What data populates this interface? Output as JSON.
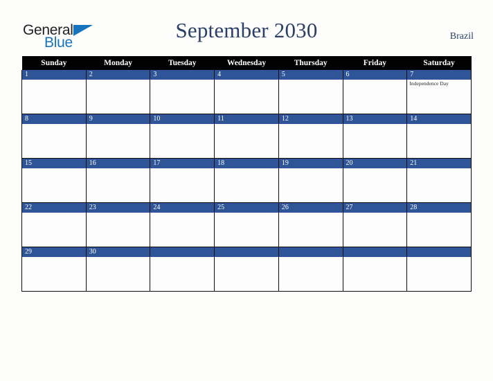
{
  "brand": {
    "name_part1": "General",
    "name_part2": "Blue",
    "accent_color": "#1574bb",
    "text_color": "#231f20"
  },
  "header": {
    "title": "September 2030",
    "country": "Brazil",
    "title_color": "#2b4065"
  },
  "calendar": {
    "month": "September",
    "year": "2030",
    "weekday_headers": [
      "Sunday",
      "Monday",
      "Tuesday",
      "Wednesday",
      "Thursday",
      "Friday",
      "Saturday"
    ],
    "header_bg": "#020202",
    "header_text": "#ffffff",
    "daynum_bg": "#2f5497",
    "daynum_text": "#ffffff",
    "weeks": [
      [
        {
          "day": "1",
          "events": []
        },
        {
          "day": "2",
          "events": []
        },
        {
          "day": "3",
          "events": []
        },
        {
          "day": "4",
          "events": []
        },
        {
          "day": "5",
          "events": []
        },
        {
          "day": "6",
          "events": []
        },
        {
          "day": "7",
          "events": [
            "Independence Day"
          ]
        }
      ],
      [
        {
          "day": "8",
          "events": []
        },
        {
          "day": "9",
          "events": []
        },
        {
          "day": "10",
          "events": []
        },
        {
          "day": "11",
          "events": []
        },
        {
          "day": "12",
          "events": []
        },
        {
          "day": "13",
          "events": []
        },
        {
          "day": "14",
          "events": []
        }
      ],
      [
        {
          "day": "15",
          "events": []
        },
        {
          "day": "16",
          "events": []
        },
        {
          "day": "17",
          "events": []
        },
        {
          "day": "18",
          "events": []
        },
        {
          "day": "19",
          "events": []
        },
        {
          "day": "20",
          "events": []
        },
        {
          "day": "21",
          "events": []
        }
      ],
      [
        {
          "day": "22",
          "events": []
        },
        {
          "day": "23",
          "events": []
        },
        {
          "day": "24",
          "events": []
        },
        {
          "day": "25",
          "events": []
        },
        {
          "day": "26",
          "events": []
        },
        {
          "day": "27",
          "events": []
        },
        {
          "day": "28",
          "events": []
        }
      ],
      [
        {
          "day": "29",
          "events": []
        },
        {
          "day": "30",
          "events": []
        },
        {
          "day": "",
          "events": []
        },
        {
          "day": "",
          "events": []
        },
        {
          "day": "",
          "events": []
        },
        {
          "day": "",
          "events": []
        },
        {
          "day": "",
          "events": []
        }
      ]
    ]
  }
}
